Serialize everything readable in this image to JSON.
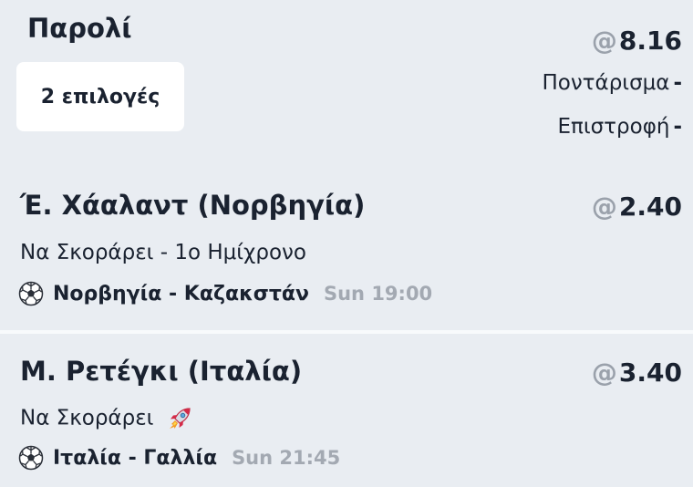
{
  "header": {
    "title": "Παρολί",
    "selections_count": "2 επιλογές",
    "odds_prefix": "@",
    "total_odds": "8.16",
    "stake_label": "Ποντάρισμα",
    "stake_value": "-",
    "return_label": "Επιστροφή",
    "return_value": "-"
  },
  "selections": [
    {
      "player": "Έ. Χάαλαντ (Νορβηγία)",
      "odds_prefix": "@",
      "odds": "2.40",
      "market": "Να Σκοράρει - 1ο Ημίχρονο",
      "match": "Νορβηγία - Καζακστάν",
      "time": "Sun 19:00",
      "icon": "soccer-ball-icon"
    },
    {
      "player": "Μ. Ρετέγκι (Ιταλία)",
      "odds_prefix": "@",
      "odds": "3.40",
      "market": "Να Σκοράρει",
      "market_icon": "rocket-icon",
      "match": "Ιταλία - Γαλλία",
      "time": "Sun 21:45",
      "icon": "soccer-ball-icon"
    }
  ]
}
